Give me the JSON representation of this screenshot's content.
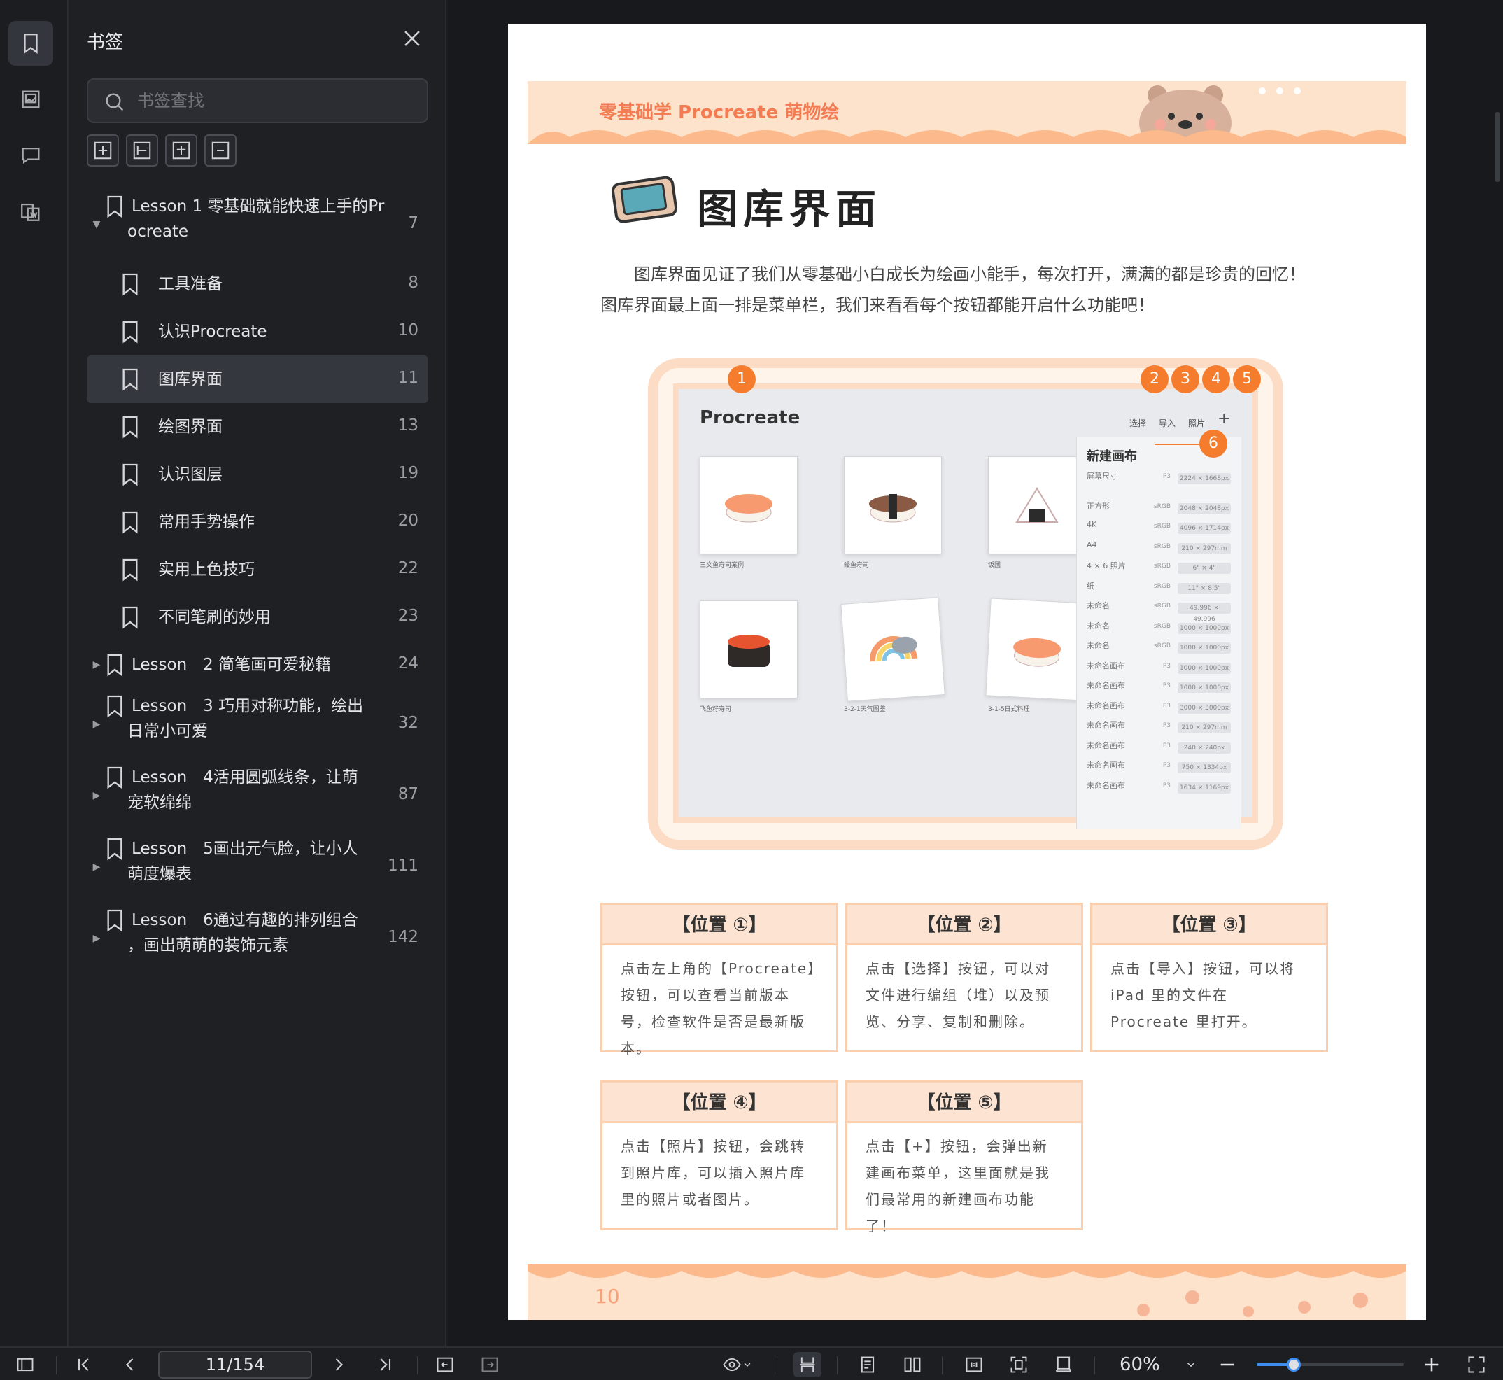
{
  "panel": {
    "title": "书签",
    "search_placeholder": "书签查找"
  },
  "bookmarks": [
    {
      "label_line1": "Lesson 1 零基础就能快速上手的Pr",
      "label_line2": "ocreate",
      "page": "7",
      "level": 0,
      "expanded": true
    },
    {
      "label_line1": "工具准备",
      "label_line2": "",
      "page": "8",
      "level": 1
    },
    {
      "label_line1": "认识Procreate",
      "label_line2": "",
      "page": "10",
      "level": 1
    },
    {
      "label_line1": "图库界面",
      "label_line2": "",
      "page": "11",
      "level": 1,
      "active": true
    },
    {
      "label_line1": "绘图界面",
      "label_line2": "",
      "page": "13",
      "level": 1
    },
    {
      "label_line1": "认识图层",
      "label_line2": "",
      "page": "19",
      "level": 1
    },
    {
      "label_line1": "常用手势操作",
      "label_line2": "",
      "page": "20",
      "level": 1
    },
    {
      "label_line1": "实用上色技巧",
      "label_line2": "",
      "page": "22",
      "level": 1
    },
    {
      "label_line1": "不同笔刷的妙用",
      "label_line2": "",
      "page": "23",
      "level": 1
    },
    {
      "label_line1": "Lesson　2 简笔画可爱秘籍",
      "label_line2": "",
      "page": "24",
      "level": 0,
      "expanded": false
    },
    {
      "label_line1": "Lesson　3 巧用对称功能，绘出",
      "label_line2": "日常小可爱",
      "page": "32",
      "level": 0,
      "expanded": false
    },
    {
      "label_line1": "Lesson　4活用圆弧线条，让萌",
      "label_line2": "宠软绵绵",
      "page": "87",
      "level": 0,
      "expanded": false
    },
    {
      "label_line1": "Lesson　5画出元气脸，让小人",
      "label_line2": "萌度爆表",
      "page": "111",
      "level": 0,
      "expanded": false
    },
    {
      "label_line1": "Lesson　6通过有趣的排列组合",
      "label_line2": "，画出萌萌的装饰元素",
      "page": "142",
      "level": 0,
      "expanded": false
    }
  ],
  "doc": {
    "banner_title": "零基础学 Procreate 萌物绘",
    "heading": "图库界面",
    "para1": "　　图库界面见证了我们从零基础小白成长为绘画小能手，每次打开，满满的都是珍贵的回忆！",
    "para2": "图库界面最上面一排是菜单栏，我们来看看每个按钮都能开启什么功能吧！",
    "app_name": "Procreate",
    "app_actions": [
      "选择",
      "导入",
      "照片",
      "+"
    ],
    "callouts": [
      "1",
      "2",
      "3",
      "4",
      "5",
      "6"
    ],
    "thumb_captions": [
      "三文鱼寿司案例",
      "鳗鱼寿司",
      "饭团",
      "飞鱼籽寿司",
      "3-2-1天气图鉴",
      "3-1-5日式料理"
    ],
    "new_canvas": {
      "title": "新建画布",
      "rows": [
        {
          "name": "屏幕尺寸",
          "tag": "P3",
          "size": "2224 × 1668px"
        },
        {
          "name": "正方形",
          "tag": "sRGB",
          "size": "2048 × 2048px"
        },
        {
          "name": "4K",
          "tag": "sRGB",
          "size": "4096 × 1714px"
        },
        {
          "name": "A4",
          "tag": "sRGB",
          "size": "210 × 297mm"
        },
        {
          "name": "4 × 6 照片",
          "tag": "sRGB",
          "size": "6\" × 4\""
        },
        {
          "name": "纸",
          "tag": "sRGB",
          "size": "11\" × 8.5\""
        },
        {
          "name": "未命名",
          "tag": "sRGB",
          "size": "49.996 × 49.996"
        },
        {
          "name": "未命名",
          "tag": "sRGB",
          "size": "1000 × 1000px"
        },
        {
          "name": "未命名",
          "tag": "sRGB",
          "size": "1000 × 1000px"
        },
        {
          "name": "未命名画布",
          "tag": "P3",
          "size": "1000 × 1000px"
        },
        {
          "name": "未命名画布",
          "tag": "P3",
          "size": "1000 × 1000px"
        },
        {
          "name": "未命名画布",
          "tag": "P3",
          "size": "3000 × 3000px"
        },
        {
          "name": "未命名画布",
          "tag": "P3",
          "size": "210 × 297mm"
        },
        {
          "name": "未命名画布",
          "tag": "P3",
          "size": "240 × 240px"
        },
        {
          "name": "未命名画布",
          "tag": "P3",
          "size": "750 × 1334px"
        },
        {
          "name": "未命名画布",
          "tag": "P3",
          "size": "1634 × 1169px"
        }
      ]
    },
    "positions": [
      {
        "title": "【位置 ①】",
        "text": "点击左上角的【Procreate】按钮，可以查看当前版本号，检查软件是否是最新版本。"
      },
      {
        "title": "【位置 ②】",
        "text": "点击【选择】按钮，可以对文件进行编组（堆）以及预览、分享、复制和删除。"
      },
      {
        "title": "【位置 ③】",
        "text": "点击【导入】按钮，可以将 iPad 里的文件在 Procreate 里打开。"
      },
      {
        "title": "【位置 ④】",
        "text": "点击【照片】按钮，会跳转到照片库，可以插入照片库里的照片或者图片。"
      },
      {
        "title": "【位置 ⑤】",
        "text": "点击【+】按钮，会弹出新建画布菜单，这里面就是我们最常用的新建画布功能了！"
      }
    ],
    "page_number": "10"
  },
  "toolbar": {
    "page_indicator": "11/154",
    "zoom": "60%",
    "zoom_fraction": 0.25
  },
  "colors": {
    "accent": "#3d8ef0",
    "callout": "#f47c2c",
    "banner": "#fde2cc"
  }
}
